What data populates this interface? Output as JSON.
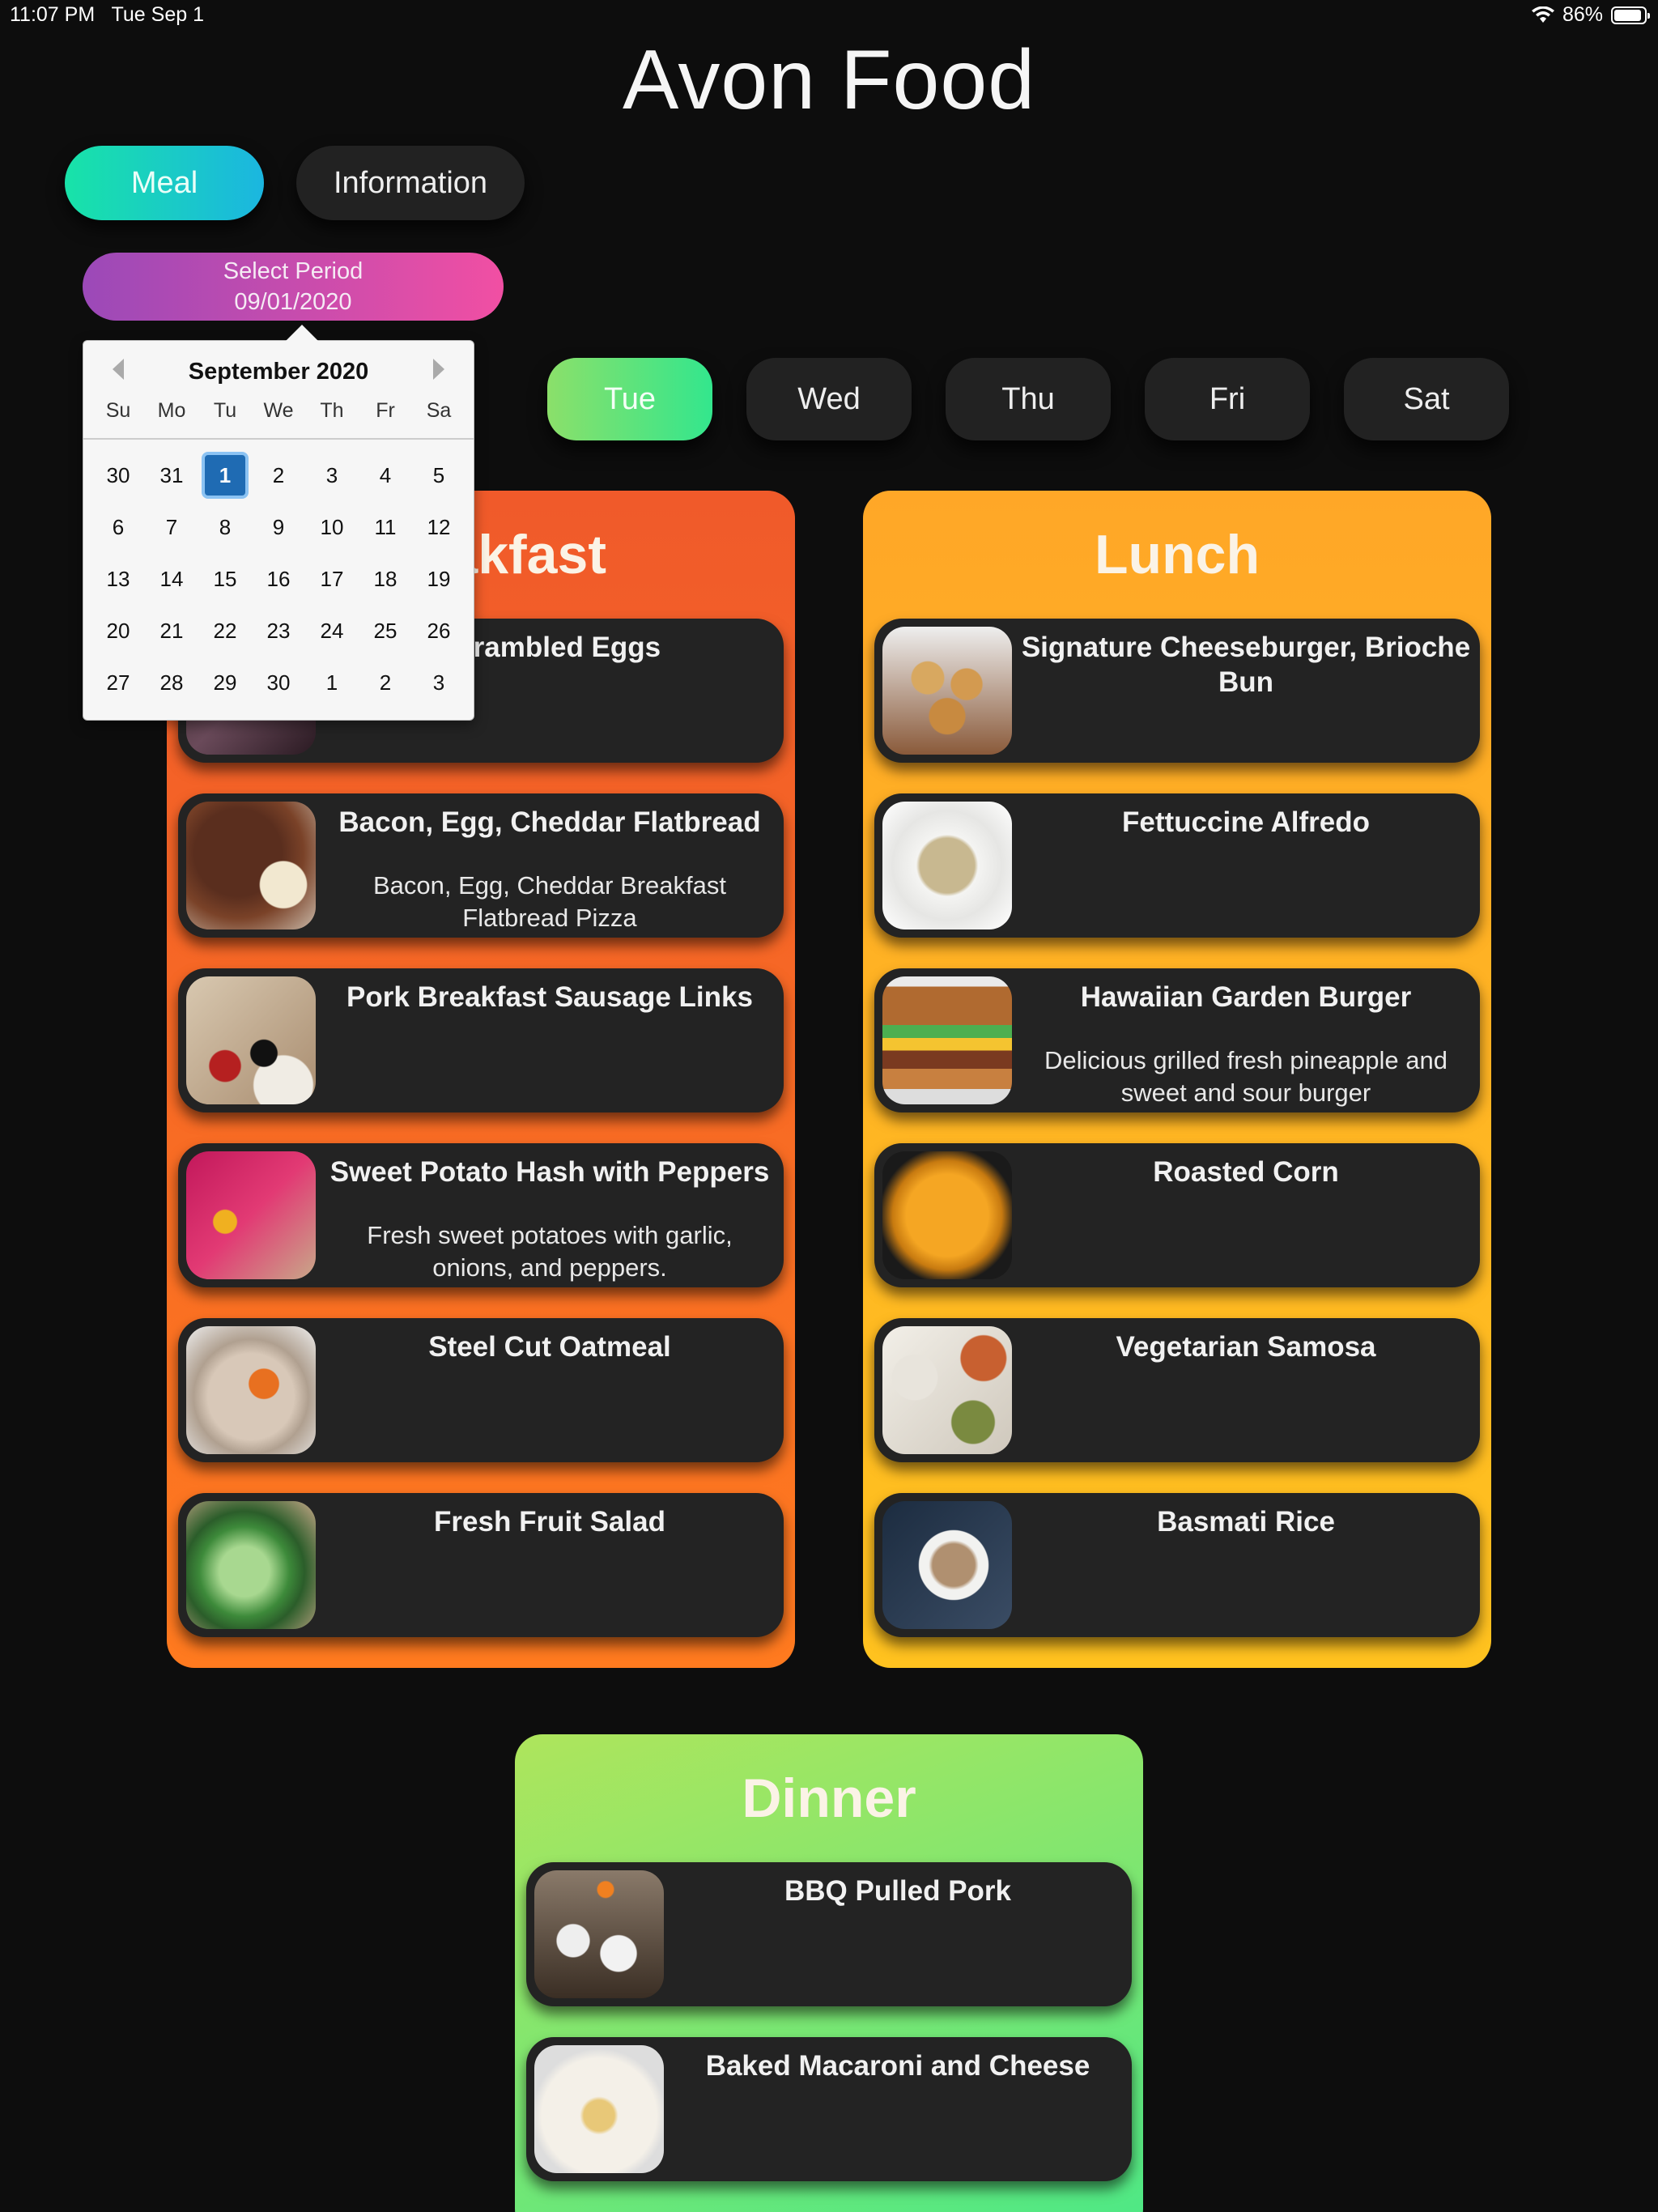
{
  "status_bar": {
    "time": "11:07 PM",
    "date": "Tue Sep 1",
    "battery": "86%",
    "wifi_icon": "wifi-icon",
    "battery_icon": "battery-icon"
  },
  "app_title": "Avon Food",
  "tabs": {
    "meal": "Meal",
    "information": "Information"
  },
  "period": {
    "label": "Select Period",
    "date": "09/01/2020"
  },
  "days": [
    "Tue",
    "Wed",
    "Thu",
    "Fri",
    "Sat"
  ],
  "selected_day": "Tue",
  "calendar": {
    "month_label": "September 2020",
    "weekdays": [
      "Su",
      "Mo",
      "Tu",
      "We",
      "Th",
      "Fr",
      "Sa"
    ],
    "days": [
      "30",
      "31",
      "1",
      "2",
      "3",
      "4",
      "5",
      "6",
      "7",
      "8",
      "9",
      "10",
      "11",
      "12",
      "13",
      "14",
      "15",
      "16",
      "17",
      "18",
      "19",
      "20",
      "21",
      "22",
      "23",
      "24",
      "25",
      "26",
      "27",
      "28",
      "29",
      "30",
      "1",
      "2",
      "3"
    ],
    "selected": "1"
  },
  "breakfast": {
    "title": "Breakfast",
    "items": [
      {
        "name": "Scrambled Eggs",
        "desc": ""
      },
      {
        "name": "Bacon, Egg, Cheddar Flatbread",
        "desc": "Bacon, Egg, Cheddar Breakfast Flatbread Pizza"
      },
      {
        "name": "Pork Breakfast Sausage Links",
        "desc": ""
      },
      {
        "name": "Sweet Potato Hash with Peppers",
        "desc": "Fresh sweet potatoes with garlic, onions, and peppers."
      },
      {
        "name": "Steel Cut Oatmeal",
        "desc": ""
      },
      {
        "name": "Fresh Fruit Salad",
        "desc": ""
      }
    ]
  },
  "lunch": {
    "title": "Lunch",
    "items": [
      {
        "name": "Signature Cheeseburger, Brioche Bun",
        "desc": ""
      },
      {
        "name": "Fettuccine Alfredo",
        "desc": ""
      },
      {
        "name": "Hawaiian Garden Burger",
        "desc": "Delicious grilled fresh pineapple and sweet and sour burger"
      },
      {
        "name": "Roasted Corn",
        "desc": ""
      },
      {
        "name": "Vegetarian Samosa",
        "desc": ""
      },
      {
        "name": "Basmati Rice",
        "desc": ""
      }
    ]
  },
  "dinner": {
    "title": "Dinner",
    "items": [
      {
        "name": "BBQ Pulled Pork",
        "desc": ""
      },
      {
        "name": "Baked Macaroni and Cheese",
        "desc": ""
      }
    ]
  },
  "colors": {
    "background": "#0d0d0d",
    "breakfast_panel": "#f05a2a",
    "lunch_panel": "#ffb323",
    "dinner_panel": "#7de874",
    "meal_tab": "#18e3a8",
    "period_button": "#c84cab",
    "selected_day": "#5ee47c",
    "calendar_selected": "#1f6bb3"
  }
}
